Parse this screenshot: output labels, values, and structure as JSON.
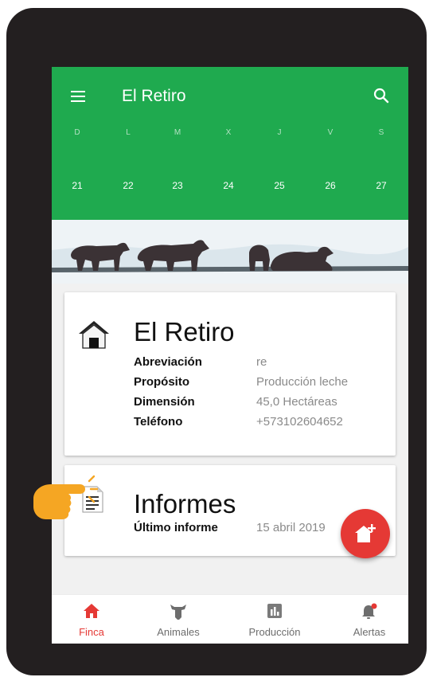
{
  "header": {
    "title": "El Retiro"
  },
  "calendar": {
    "weekdays": [
      "D",
      "L",
      "M",
      "X",
      "J",
      "V",
      "S"
    ],
    "days": [
      "21",
      "22",
      "23",
      "24",
      "25",
      "26",
      "27"
    ]
  },
  "farm_card": {
    "title": "El Retiro",
    "rows": [
      {
        "label": "Abreviación",
        "value": "re"
      },
      {
        "label": "Propósito",
        "value": "Producción leche"
      },
      {
        "label": "Dimensión",
        "value": "45,0 Hectáreas"
      },
      {
        "label": "Teléfono",
        "value": "+573102604652"
      }
    ]
  },
  "reports_card": {
    "title": "Informes",
    "last_report_label": "Último informe",
    "last_report_value": "15 abril 2019"
  },
  "bottom_nav": {
    "items": [
      {
        "label": "Finca",
        "icon": "home-icon",
        "active": true
      },
      {
        "label": "Animales",
        "icon": "cow-icon",
        "active": false
      },
      {
        "label": "Producción",
        "icon": "bar-chart-icon",
        "active": false
      },
      {
        "label": "Alertas",
        "icon": "bell-icon",
        "active": false
      }
    ]
  },
  "colors": {
    "primary": "#1faa4f",
    "accent": "#e53935",
    "frame": "#231f20",
    "pointer": "#f5a623"
  },
  "fab": {
    "icon": "add-home-icon"
  }
}
